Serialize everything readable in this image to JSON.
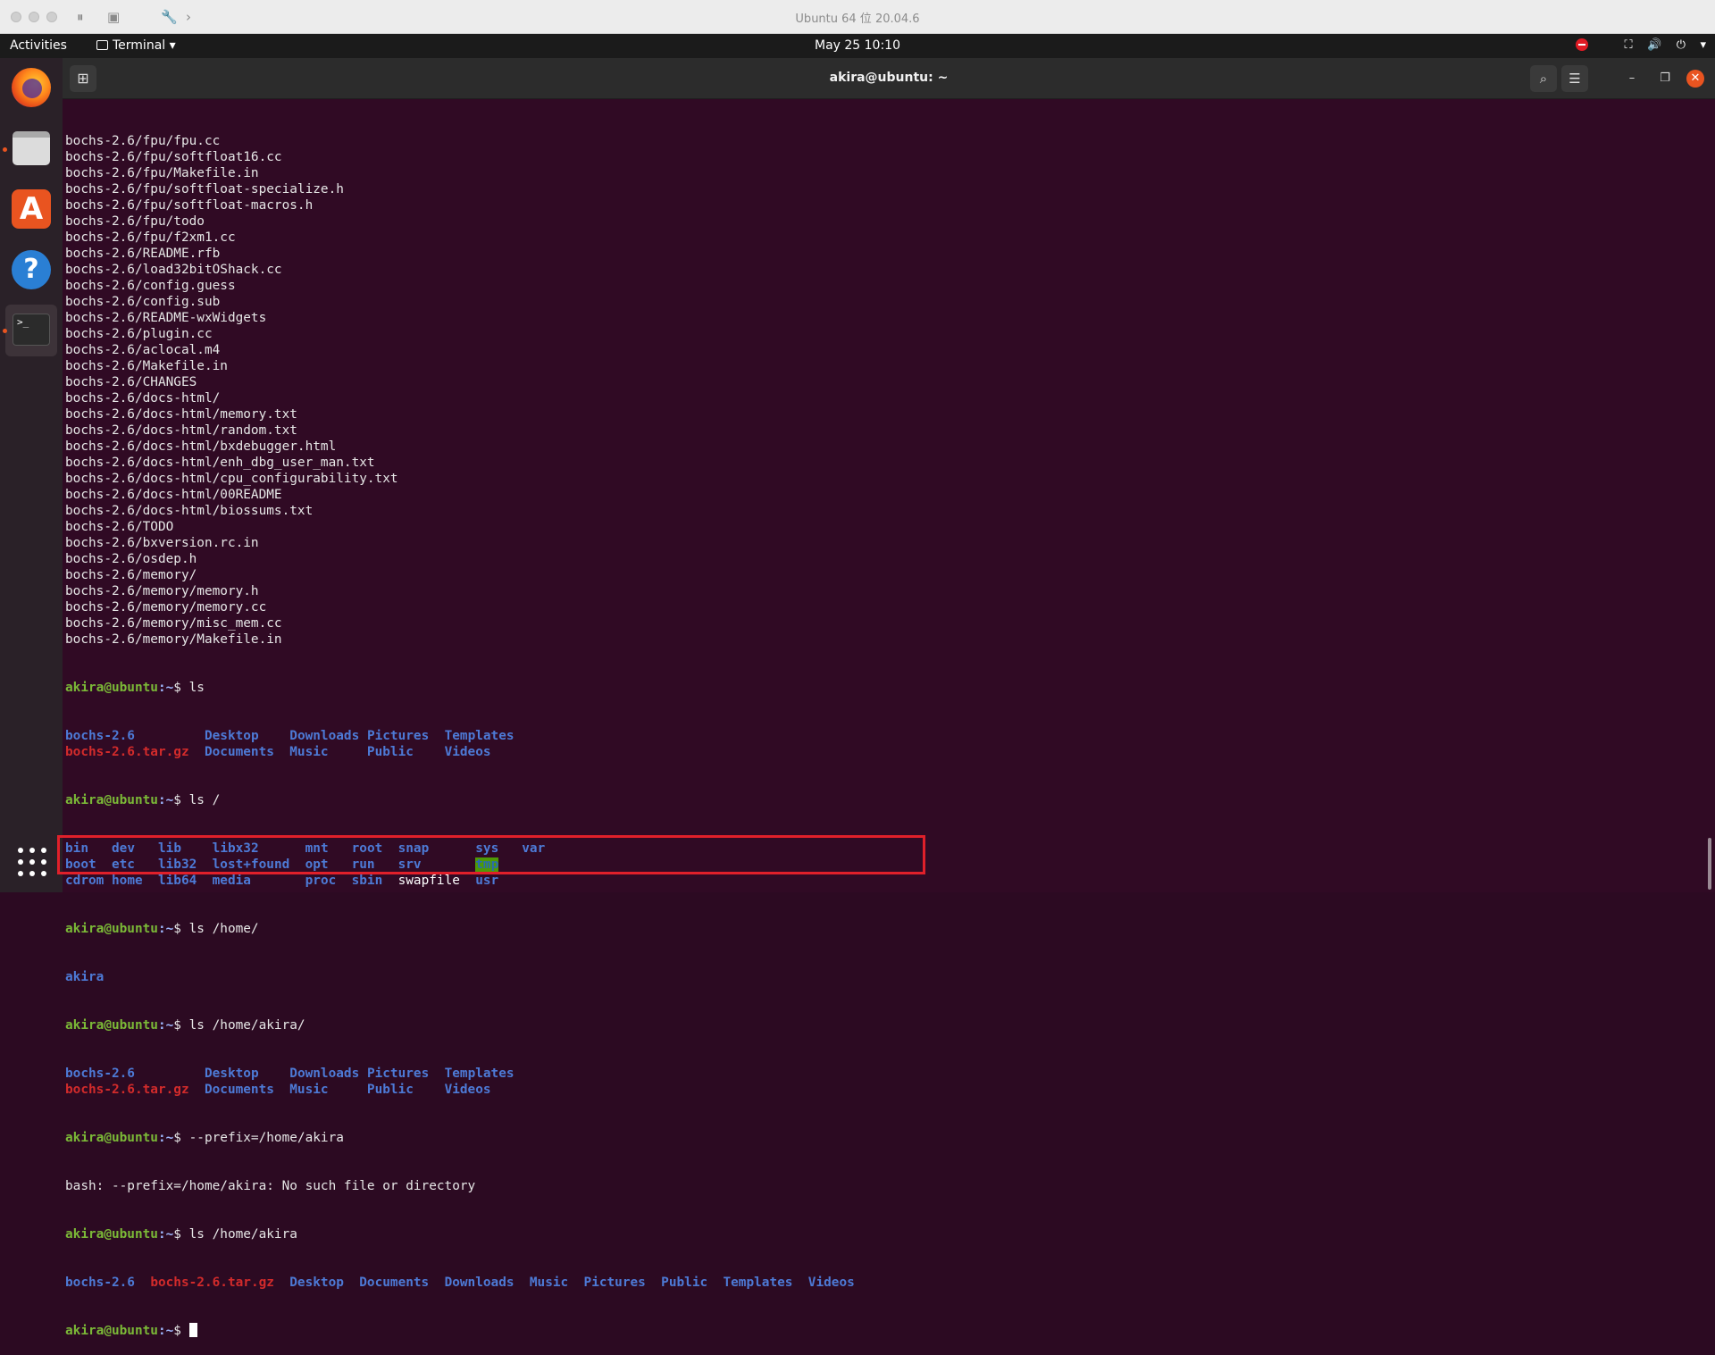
{
  "host": {
    "title": "Ubuntu 64 位 20.04.6"
  },
  "topbar": {
    "activities": "Activities",
    "app_menu": "Terminal",
    "clock": "May 25  10:10"
  },
  "window": {
    "title": "akira@ubuntu: ~"
  },
  "terminal": {
    "prompt_user": "akira@ubuntu",
    "prompt_path": ":~",
    "listing": [
      "bochs-2.6/fpu/fpu.cc",
      "bochs-2.6/fpu/softfloat16.cc",
      "bochs-2.6/fpu/Makefile.in",
      "bochs-2.6/fpu/softfloat-specialize.h",
      "bochs-2.6/fpu/softfloat-macros.h",
      "bochs-2.6/fpu/todo",
      "bochs-2.6/fpu/f2xm1.cc",
      "bochs-2.6/README.rfb",
      "bochs-2.6/load32bitOShack.cc",
      "bochs-2.6/config.guess",
      "bochs-2.6/config.sub",
      "bochs-2.6/README-wxWidgets",
      "bochs-2.6/plugin.cc",
      "bochs-2.6/aclocal.m4",
      "bochs-2.6/Makefile.in",
      "bochs-2.6/CHANGES",
      "bochs-2.6/docs-html/",
      "bochs-2.6/docs-html/memory.txt",
      "bochs-2.6/docs-html/random.txt",
      "bochs-2.6/docs-html/bxdebugger.html",
      "bochs-2.6/docs-html/enh_dbg_user_man.txt",
      "bochs-2.6/docs-html/cpu_configurability.txt",
      "bochs-2.6/docs-html/00README",
      "bochs-2.6/docs-html/biossums.txt",
      "bochs-2.6/TODO",
      "bochs-2.6/bxversion.rc.in",
      "bochs-2.6/osdep.h",
      "bochs-2.6/memory/",
      "bochs-2.6/memory/memory.h",
      "bochs-2.6/memory/memory.cc",
      "bochs-2.6/memory/misc_mem.cc",
      "bochs-2.6/memory/Makefile.in"
    ],
    "cmd1": "$ ls",
    "home1": {
      "bochs_dir": "bochs-2.6",
      "bochs_archive": "bochs-2.6.tar.gz",
      "col2": [
        "Desktop",
        "Documents"
      ],
      "col3": [
        "Downloads",
        "Music"
      ],
      "col4": [
        "Pictures",
        "Public"
      ],
      "col5": [
        "Templates",
        "Videos"
      ]
    },
    "cmd2": "$ ls /",
    "root_row1": [
      "bin",
      "dev",
      "lib",
      "libx32",
      "mnt",
      "root",
      "snap",
      "sys",
      "var"
    ],
    "root_row2": [
      "boot",
      "etc",
      "lib32",
      "lost+found",
      "opt",
      "run",
      "srv",
      "tmp"
    ],
    "root_row3": [
      "cdrom",
      "home",
      "lib64",
      "media",
      "proc",
      "sbin",
      "swapfile",
      "usr"
    ],
    "cmd3": "$ ls /home/",
    "home_out": "akira",
    "cmd4": "$ ls /home/akira/",
    "cmd5": "$ --prefix=/home/akira",
    "error": "bash: --prefix=/home/akira: No such file or directory",
    "cmd6": "$ ls /home/akira",
    "final_row": [
      "bochs-2.6",
      "bochs-2.6.tar.gz",
      "Desktop",
      "Documents",
      "Downloads",
      "Music",
      "Pictures",
      "Public",
      "Templates",
      "Videos"
    ],
    "last_prompt": "$ "
  }
}
